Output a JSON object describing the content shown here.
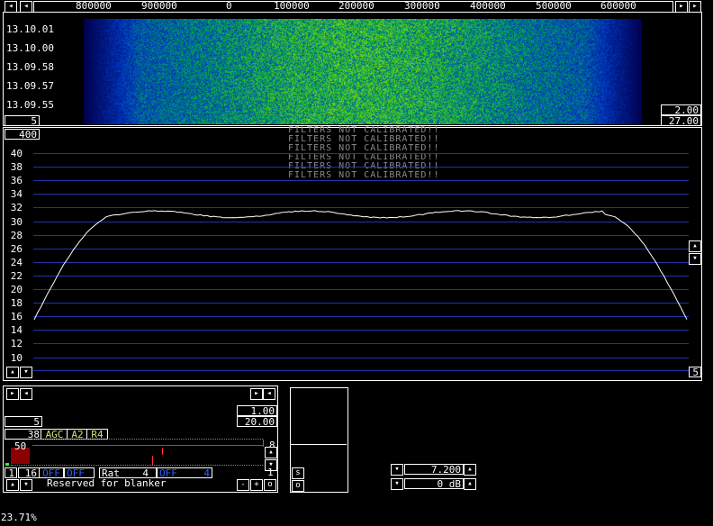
{
  "waterfall": {
    "freq_ticks": [
      "800000",
      "900000",
      "0",
      "100000",
      "200000",
      "300000",
      "400000",
      "500000",
      "600000"
    ],
    "time_labels": [
      "13.10.01",
      "13.10.00",
      "13.09.58",
      "13.09.57",
      "13.09.55"
    ],
    "left_box": "5",
    "right_top_box": "2.00",
    "right_bottom_box": "27.00"
  },
  "spectrum": {
    "top_box": "400",
    "warning_lines": [
      "FILTERS NOT CALIBRATED!!",
      "FILTERS NOT CALIBRATED!!",
      "FILTERS NOT CALIBRATED!!",
      "FILTERS NOT CALIBRATED!!",
      "FILTERS NOT CALIBRATED!!",
      "FILTERS NOT CALIBRATED!!"
    ],
    "y_labels": [
      "40",
      "38",
      "36",
      "34",
      "32",
      "30",
      "28",
      "26",
      "24",
      "22",
      "20",
      "18",
      "16",
      "14",
      "12",
      "10"
    ],
    "bottom_right_box": "5",
    "grid_color": "#2233aa",
    "trace_color": "#ffffff"
  },
  "control": {
    "box_5": "5",
    "box_1_00": "1.00",
    "box_20_00": "20.00",
    "box_38": "38",
    "agc_label": "AGC",
    "a2_label": "A2",
    "r4_label": "R4",
    "s_meter_value": "50",
    "right_value_8": "8",
    "right_value_1": "1",
    "box_1": "1",
    "box_16": "16",
    "off1": "OFF",
    "off2": "OFF",
    "rat_label": "Rat",
    "rat_value": "4",
    "off3": "OFF",
    "blue_value": "4",
    "blanker_text": "Reserved for blanker",
    "minus_btn": "-",
    "plus_btn": "+",
    "o_btn": "o"
  },
  "small_panel": {
    "s_btn": "s",
    "o_btn": "o"
  },
  "freq_controls": {
    "frequency": "7.200",
    "gain": "0 dB"
  },
  "status": {
    "cpu_load": "23.71%"
  },
  "icons": {
    "left": "left-arrow-icon",
    "right": "right-arrow-icon",
    "up": "up-arrow-icon",
    "down": "down-arrow-icon"
  }
}
